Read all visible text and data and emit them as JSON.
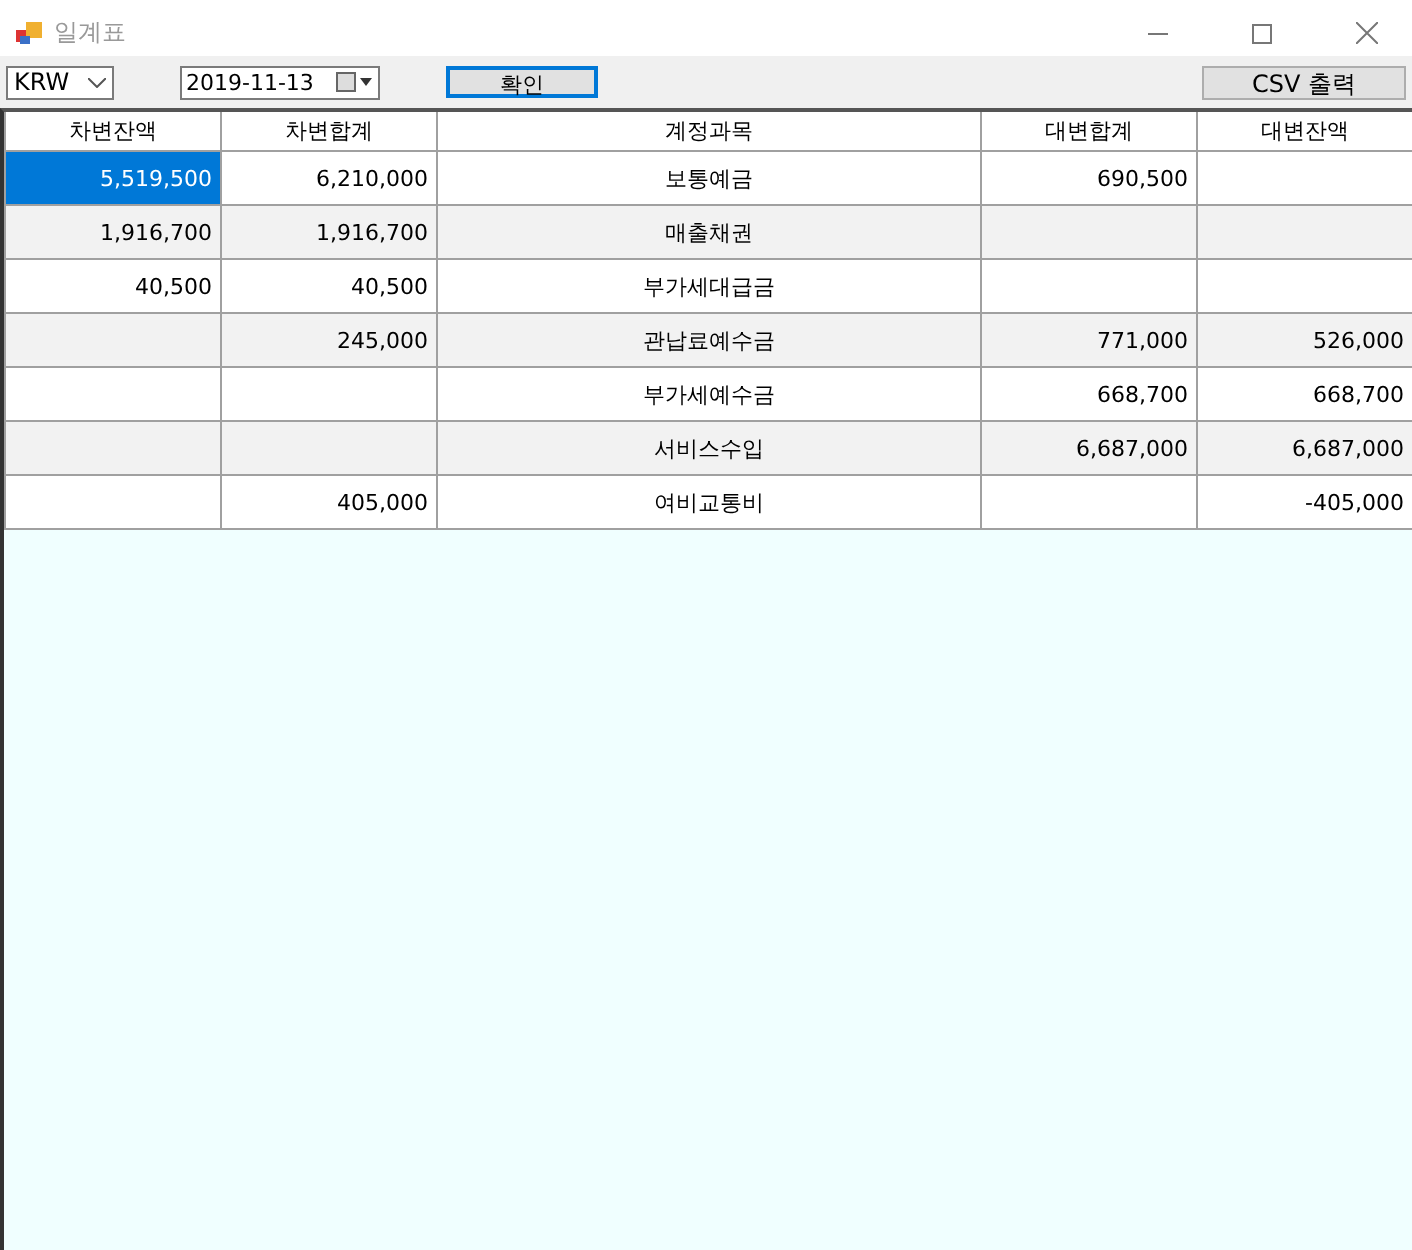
{
  "window": {
    "title": "일계표"
  },
  "toolbar": {
    "currency": "KRW",
    "date": "2019-11-13",
    "confirm_button": "확인",
    "export_button": "CSV 출력"
  },
  "table": {
    "columns": [
      "차변잔액",
      "차변합계",
      "계정과목",
      "대변합계",
      "대변잔액"
    ],
    "rows": [
      {
        "cells": [
          {
            "text": "5,519,500",
            "selected": true
          },
          {
            "text": "6,210,000",
            "selected": false
          },
          {
            "text": "보통예금",
            "selected": false
          },
          {
            "text": "690,500",
            "selected": false
          },
          {
            "selected": false
          }
        ]
      },
      {
        "cells": [
          {
            "text": "1,916,700",
            "selected": false
          },
          {
            "text": "1,916,700",
            "selected": false
          },
          {
            "text": "매출채권",
            "selected": false
          },
          {
            "selected": false
          },
          {
            "selected": false
          }
        ]
      },
      {
        "cells": [
          {
            "text": "40,500",
            "selected": false
          },
          {
            "text": "40,500",
            "selected": false
          },
          {
            "text": "부가세대급금",
            "selected": false
          },
          {
            "selected": false
          },
          {
            "selected": false
          }
        ]
      },
      {
        "cells": [
          {
            "selected": false
          },
          {
            "text": "245,000",
            "selected": false
          },
          {
            "text": "관납료예수금",
            "selected": false
          },
          {
            "text": "771,000",
            "selected": false
          },
          {
            "text": "526,000",
            "selected": false
          }
        ]
      },
      {
        "cells": [
          {
            "selected": false
          },
          {
            "selected": false
          },
          {
            "text": "부가세예수금",
            "selected": false
          },
          {
            "text": "668,700",
            "selected": false
          },
          {
            "text": "668,700",
            "selected": false
          }
        ]
      },
      {
        "cells": [
          {
            "selected": false
          },
          {
            "selected": false
          },
          {
            "text": "서비스수입",
            "selected": false
          },
          {
            "text": "6,687,000",
            "selected": false
          },
          {
            "text": "6,687,000",
            "selected": false
          }
        ]
      },
      {
        "cells": [
          {
            "selected": false
          },
          {
            "text": "405,000",
            "selected": false
          },
          {
            "text": "여비교통비",
            "selected": false
          },
          {
            "selected": false
          },
          {
            "text": "-405,000",
            "selected": false
          }
        ]
      }
    ]
  }
}
